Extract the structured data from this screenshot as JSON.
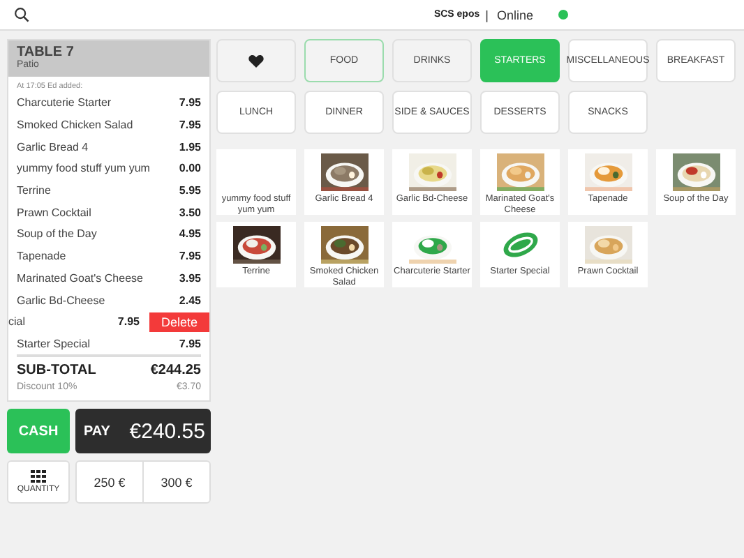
{
  "top_bar": {
    "brand": "SCS epos",
    "separator": "|",
    "status": "Online",
    "online": true
  },
  "order": {
    "title": "TABLE 7",
    "subtitle": "Patio",
    "note": "At 17:05 Ed added:",
    "lines": [
      {
        "name": "Charcuterie Starter",
        "price": "7.95",
        "kind": "item"
      },
      {
        "name": "Smoked Chicken Salad",
        "price": "7.95",
        "kind": "item"
      },
      {
        "name": "Garlic Bread 4",
        "price": "1.95",
        "kind": "item"
      },
      {
        "name": "yummy food stuff yum yum",
        "price": "0.00",
        "kind": "item"
      },
      {
        "name": "Terrine",
        "price": "5.95",
        "kind": "item"
      },
      {
        "name": "Prawn Cocktail",
        "price": "3.50",
        "kind": "item"
      },
      {
        "name": "Soup of the Day",
        "price": "4.95",
        "kind": "item"
      },
      {
        "name": "Tapenade",
        "price": "7.95",
        "kind": "item"
      },
      {
        "name": "Marinated Goat's Cheese",
        "price": "3.95",
        "kind": "item"
      },
      {
        "name": "Garlic Bd-Cheese",
        "price": "2.45",
        "kind": "item"
      },
      {
        "name": "cial",
        "price": "7.95",
        "kind": "swiped",
        "action": "Delete"
      },
      {
        "name": "Starter Special",
        "price": "7.95",
        "kind": "item"
      }
    ],
    "subtotal": {
      "label": "SUB-TOTAL",
      "value": "€244.25"
    },
    "discount": {
      "label": "Discount 10%",
      "value": "€3.70"
    }
  },
  "actions": {
    "cash": "CASH",
    "pay_label": "PAY",
    "pay_amount": "€240.55",
    "quantity": "QUANTITY",
    "quick_amounts": [
      "250 €",
      "300 €"
    ]
  },
  "categories": [
    {
      "kind": "favourites",
      "selected": false
    },
    {
      "label": "FOOD",
      "kind": "text",
      "selected": false,
      "outlined": true
    },
    {
      "label": "DRINKS",
      "kind": "text",
      "selected": false
    },
    {
      "label": "STARTERS",
      "kind": "text",
      "selected": true
    },
    {
      "label": "MISCELLANEOUS",
      "kind": "text",
      "selected": false
    },
    {
      "label": "BREAKFAST",
      "kind": "text",
      "selected": false
    },
    {
      "label": "LUNCH",
      "kind": "text",
      "selected": false
    },
    {
      "label": "DINNER",
      "kind": "text",
      "selected": false
    },
    {
      "label": "SIDE & SAUCES",
      "kind": "text",
      "selected": false
    },
    {
      "label": "DESSERTS",
      "kind": "text",
      "selected": false
    },
    {
      "label": "SNACKS",
      "kind": "text",
      "selected": false
    }
  ],
  "products": [
    {
      "name": "yummy food stuff yum yum",
      "kind": "text"
    },
    {
      "name": "Garlic Bread 4",
      "kind": "picture"
    },
    {
      "name": "Garlic Bd-Cheese",
      "kind": "picture"
    },
    {
      "name": "Marinated Goat's Cheese",
      "kind": "picture"
    },
    {
      "name": "Tapenade",
      "kind": "picture"
    },
    {
      "name": "Soup of the Day",
      "kind": "picture"
    },
    {
      "name": "Terrine",
      "kind": "picture"
    },
    {
      "name": "Smoked Chicken Salad",
      "kind": "picture"
    },
    {
      "name": "Charcuterie Starter",
      "kind": "picture"
    },
    {
      "name": "Starter Special",
      "kind": "picture"
    },
    {
      "name": "Prawn Cocktail",
      "kind": "picture"
    }
  ]
}
